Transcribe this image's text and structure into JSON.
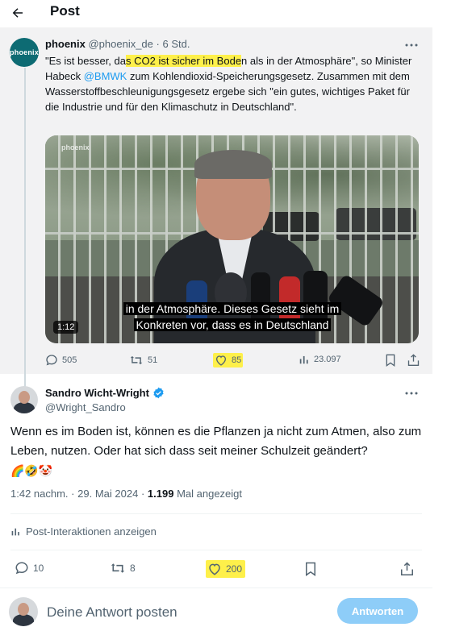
{
  "header": {
    "title": "Post",
    "back_icon": "arrow-left-icon"
  },
  "quoted_post": {
    "author_name": "phoenix",
    "handle": "@phoenix_de",
    "separator": "·",
    "time": "6 Std.",
    "avatar_label": "phoenix",
    "text_part1": "\"Es ist besser, da",
    "text_highlight": "s CO2 ist sicher im Bode",
    "text_part2": "n als in der Atmosphäre\", so Minister Habeck ",
    "mention": "@BMWK",
    "text_part3": " zum Kohlendioxid-Speicherungsgesetz. Zusammen mit dem Wasserstoffbeschleunigungsgesetz ergebe sich \"ein gutes, wichtiges Paket für die Industrie und für den Klimaschutz in Deutschland\".",
    "video": {
      "subtitle_line1": "in der Atmosphäre. Dieses Gesetz sieht im",
      "subtitle_line2": "Konkreten vor, dass es in Deutschland",
      "duration": "1:12",
      "watermark": "phoenix"
    },
    "actions": {
      "replies": "505",
      "reposts": "51",
      "likes": "85",
      "views": "23.097"
    }
  },
  "reply_post": {
    "author_name": "Sandro Wicht-Wright",
    "handle": "@Wright_Sandro",
    "text": "Wenn es im Boden ist, können es die Pflanzen ja nicht zum Atmen, also zum Leben, nutzen. Oder hat sich dass seit meiner Schulzeit geändert?",
    "emojis": "🌈🤣🤡",
    "time": "1:42 nachm.",
    "separator": "·",
    "date": "29. Mai 2024",
    "views_count": "1.199",
    "views_label": "Mal angezeigt",
    "interactions_label": "Post-Interaktionen anzeigen",
    "actions": {
      "replies": "10",
      "reposts": "8",
      "likes": "200"
    }
  },
  "compose": {
    "placeholder": "Deine Antwort posten",
    "button_label": "Antworten"
  },
  "colors": {
    "accent": "#1d9bf0",
    "highlight": "#fef04a",
    "muted": "#536471",
    "quoted_bg": "#f2f2f3",
    "reply_button": "#8ecdf8"
  }
}
